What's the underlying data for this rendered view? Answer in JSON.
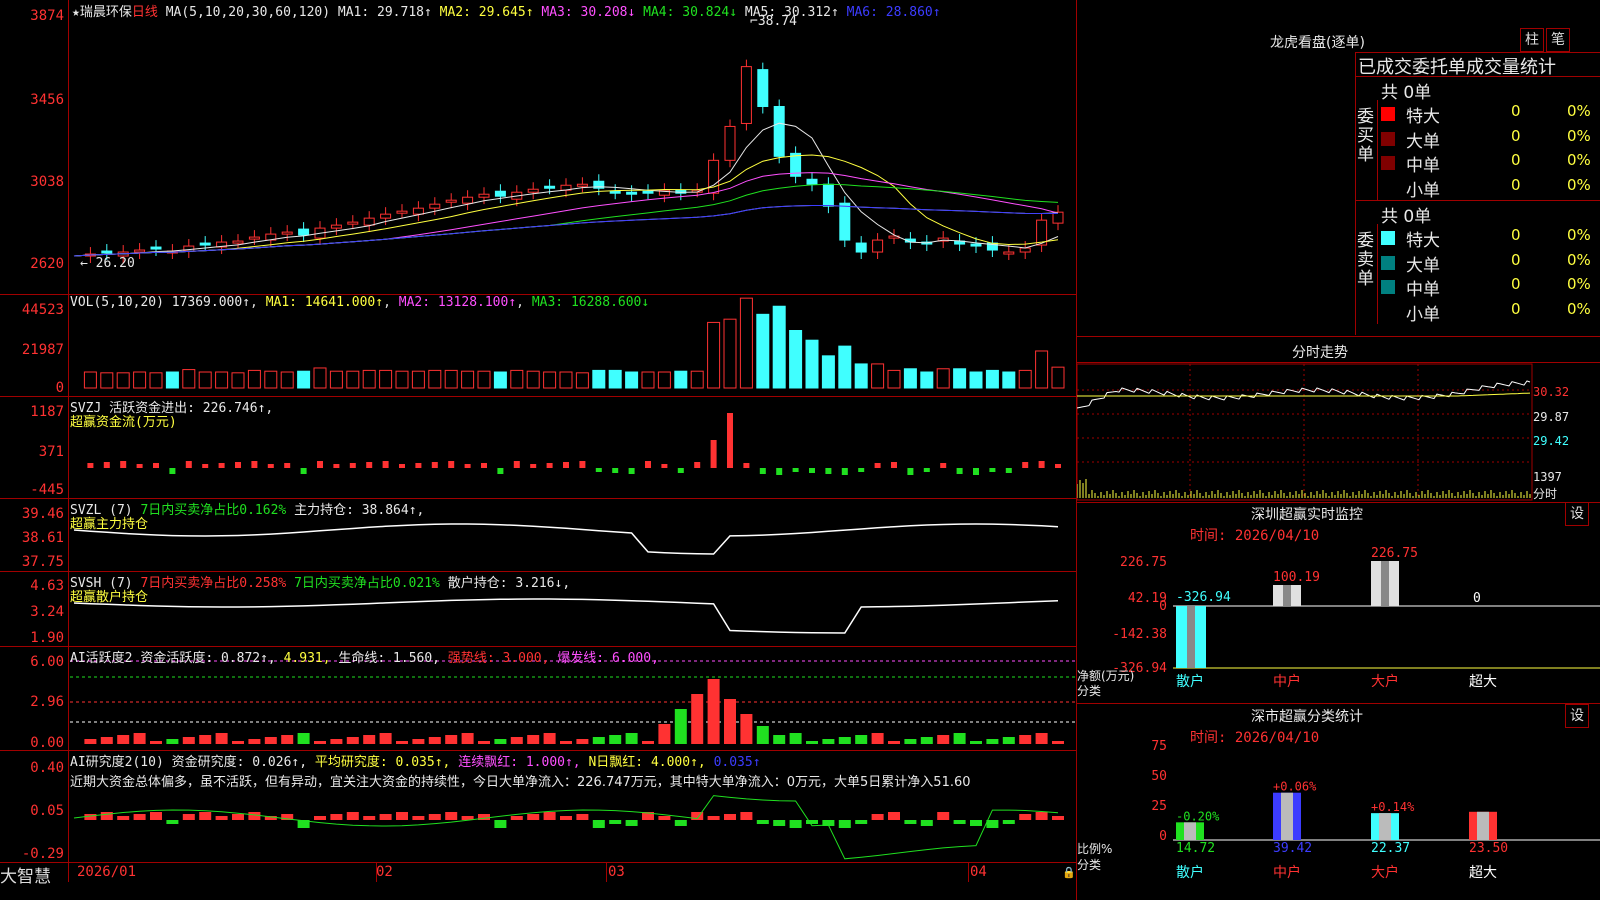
{
  "kline_header": {
    "star": "★",
    "name": "瑞晨环保",
    "period": "日线",
    "ma_spec": "MA(5,10,20,30,60,120)",
    "ma1": "MA1: 29.718↑",
    "ma2": "MA2: 29.645↑",
    "ma3": "MA3: 30.208↓",
    "ma4": "MA4: 30.824↓",
    "ma5": "MA5: 30.312↑",
    "ma6": "MA6: 28.860↑"
  },
  "kline_axis": [
    "3874",
    "3456",
    "3038",
    "2620"
  ],
  "kline_high_label": "38.74",
  "kline_low_label": "26.20",
  "vol_header": {
    "spec": "VOL(5,10,20)",
    "vol": "17369.000↑",
    "ma1": "MA1: 14641.000↑",
    "ma2": "MA2: 13128.100↑",
    "ma3": "MA3: 16288.600↓"
  },
  "vol_axis": [
    "44523",
    "21987",
    "0"
  ],
  "svzj_header": {
    "name": "SVZJ",
    "label": "活跃资金进出: 226.746↑,",
    "sub": "超赢资金流(万元)"
  },
  "svzj_axis": [
    "1187",
    "371",
    "-445"
  ],
  "svzl_header": {
    "name": "SVZL (7)",
    "label1": "7日内买卖净占比0.162%",
    "label2": "主力持仓: 38.864↑,",
    "sub": "超赢主力持仓"
  },
  "svzl_axis": [
    "39.46",
    "38.61",
    "37.75"
  ],
  "svsh_header": {
    "name": "SVSH (7)",
    "label1": "7日内买卖净占比0.258%",
    "label2": "7日内买卖净占比0.021%",
    "label3": "散户持仓: 3.216↓,",
    "sub": "超赢散户持仓"
  },
  "svsh_axis": [
    "4.63",
    "3.24",
    "1.90"
  ],
  "ai1_header": {
    "name": "AI活跃度2",
    "label1": "资金活跃度: 0.872↑,",
    "label2": "4.931,",
    "label3": "生命线: 1.560,",
    "label4": "强势线: 3.000,",
    "label5": "爆发线: 6.000,"
  },
  "ai1_axis": [
    "6.00",
    "2.96",
    "0.00"
  ],
  "ai2_header": {
    "name": "AI研究度2(10)",
    "label1": "资金研究度: 0.026↑,",
    "label2": "平均研究度: 0.035↑,",
    "label3": "连续飘红: 1.000↑,",
    "label4": "N日飘红: 4.000↑,",
    "label5": "0.035↑",
    "summary": "近期大资金总体偏多，虽不活跃，但有异动，宜关注大资金的持续性，今日大单净流入：226.747万元，其中特大单净流入：0万元，大单5日累计净入51.60"
  },
  "ai2_axis": [
    "0.40",
    "0.05",
    "-0.29"
  ],
  "bottom": {
    "brand": "大智慧",
    "dates": [
      "2026/01",
      "02",
      "03",
      "04"
    ]
  },
  "right_panel": {
    "lhb_title": "龙虎看盘(逐单)",
    "btn1": "柱",
    "btn2": "笔",
    "tabs_title": "已成交委托单成交量统计",
    "buy_label": "委买单",
    "sell_label": "委卖单",
    "buy_total": "共 0单",
    "sell_total": "共 0单",
    "rows": [
      {
        "label": "特大",
        "count": "0",
        "pct": "0%"
      },
      {
        "label": "大单",
        "count": "0",
        "pct": "0%"
      },
      {
        "label": "中单",
        "count": "0",
        "pct": "0%"
      },
      {
        "label": "小单",
        "count": "0",
        "pct": "0%"
      }
    ],
    "minute_title": "分时走势",
    "minute_axis": [
      "30.32",
      "29.87",
      "29.42",
      "1397"
    ],
    "minute_fen": "分时",
    "sz_title": "深圳超赢实时监控",
    "sz_btn": "设",
    "sz_time": "时间: 2026/04/10",
    "sz_axis": [
      "226.75",
      "42.19",
      "0",
      "-142.38",
      "-326.94"
    ],
    "sz_values": {
      "sanhu": "-326.94",
      "zhonghu": "100.19",
      "dahu": "226.75",
      "chaoda": "0"
    },
    "sz_ylabel1": "净额(万元)",
    "sz_ylabel2": "分类",
    "categories": [
      "散户",
      "中户",
      "大户",
      "超大"
    ],
    "cls_title": "深市超赢分类统计",
    "cls_btn": "设",
    "cls_time": "时间: 2026/04/10",
    "cls_axis": [
      "75",
      "50",
      "25",
      "0"
    ],
    "cls_values": [
      "14.72",
      "39.42",
      "22.37",
      "23.50"
    ],
    "cls_changes": [
      "-0.20%",
      "+0.06%",
      "+0.14%",
      ""
    ],
    "cls_ylabel1": "比例%",
    "cls_ylabel2": "分类"
  }
}
